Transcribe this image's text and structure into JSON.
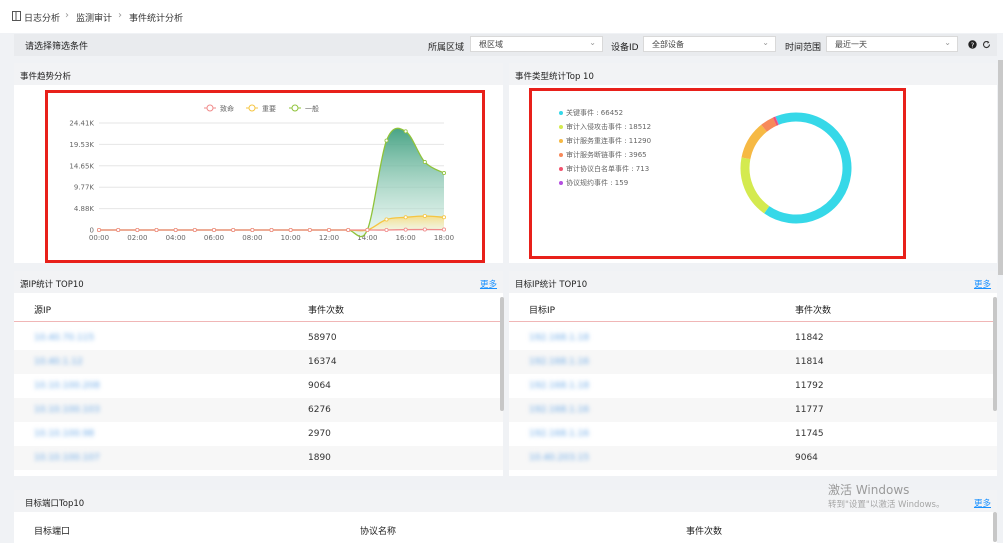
{
  "breadcrumb": {
    "items": [
      "日志分析",
      "监测审计",
      "事件统计分析"
    ]
  },
  "filters": {
    "title": "请选择筛选条件",
    "region": {
      "label": "所属区域",
      "value": "根区域"
    },
    "device": {
      "label": "设备ID",
      "value": "全部设备"
    },
    "timerange": {
      "label": "时间范围",
      "value": "最近一天"
    }
  },
  "trend": {
    "title": "事件趋势分析"
  },
  "toptypes": {
    "title": "事件类型统计Top 10",
    "legend": [
      {
        "label": "关键事件 : 66452",
        "color": "#36d8e8"
      },
      {
        "label": "审计入侵攻击事件 : 18512",
        "color": "#d4ea4f"
      },
      {
        "label": "审计服务重连事件 : 11290",
        "color": "#f6b944"
      },
      {
        "label": "审计服务断链事件 : 3965",
        "color": "#f7895a"
      },
      {
        "label": "审计协议白名单事件 : 713",
        "color": "#f1546f"
      },
      {
        "label": "协议规约事件 : 159",
        "color": "#b44fe0"
      }
    ]
  },
  "chart_data": [
    {
      "type": "line",
      "legend": [
        "致命",
        "重要",
        "一般"
      ],
      "colors": [
        "#f08a8a",
        "#f5c542",
        "#8fc33a"
      ],
      "x": [
        "00:00",
        "01:00",
        "02:00",
        "03:00",
        "04:00",
        "05:00",
        "06:00",
        "07:00",
        "08:00",
        "09:00",
        "10:00",
        "11:00",
        "12:00",
        "13:00",
        "14:00",
        "15:00",
        "16:00",
        "17:00",
        "18:00"
      ],
      "xticks": [
        "00:00",
        "02:00",
        "04:00",
        "06:00",
        "08:00",
        "10:00",
        "12:00",
        "14:00",
        "16:00",
        "18:00"
      ],
      "yticks": [
        "0",
        "4.88K",
        "9.77K",
        "14.65K",
        "19.53K",
        "24.41K"
      ],
      "ylim": [
        0,
        24410
      ],
      "series": [
        {
          "name": "致命",
          "values": [
            0,
            0,
            0,
            0,
            0,
            0,
            0,
            0,
            0,
            0,
            0,
            0,
            0,
            0,
            0,
            0,
            80,
            120,
            100
          ]
        },
        {
          "name": "重要",
          "values": [
            0,
            0,
            0,
            0,
            0,
            0,
            0,
            0,
            0,
            0,
            0,
            0,
            0,
            0,
            0,
            2400,
            2900,
            3200,
            2900
          ]
        },
        {
          "name": "一般",
          "values": [
            0,
            0,
            0,
            0,
            0,
            0,
            0,
            0,
            0,
            0,
            0,
            0,
            0,
            0,
            0,
            20400,
            22500,
            15500,
            13000
          ]
        }
      ]
    },
    {
      "type": "pie",
      "categories": [
        "关键事件",
        "审计入侵攻击事件",
        "审计服务重连事件",
        "审计服务断链事件",
        "审计协议白名单事件",
        "协议规约事件"
      ],
      "values": [
        66452,
        18512,
        11290,
        3965,
        713,
        159
      ]
    }
  ],
  "source_ip": {
    "title": "源IP统计 TOP10",
    "more": "更多",
    "headers": [
      "源IP",
      "事件次数"
    ],
    "rows": [
      {
        "ip": "10.40.70.115",
        "count": "58970"
      },
      {
        "ip": "10.40.1.12",
        "count": "16374"
      },
      {
        "ip": "10.10.100.208",
        "count": "9064"
      },
      {
        "ip": "10.10.100.103",
        "count": "6276"
      },
      {
        "ip": "10.10.100.98",
        "count": "2970"
      },
      {
        "ip": "10.10.100.107",
        "count": "1890"
      }
    ]
  },
  "target_ip": {
    "title": "目标IP统计 TOP10",
    "more": "更多",
    "headers": [
      "目标IP",
      "事件次数"
    ],
    "rows": [
      {
        "ip": "192.168.1.18",
        "count": "11842"
      },
      {
        "ip": "192.168.1.16",
        "count": "11814"
      },
      {
        "ip": "192.168.1.18",
        "count": "11792"
      },
      {
        "ip": "192.168.1.16",
        "count": "11777"
      },
      {
        "ip": "192.168.1.16",
        "count": "11745"
      },
      {
        "ip": "10.40.203.15",
        "count": "9064"
      }
    ]
  },
  "target_port": {
    "title": "目标端口Top10",
    "more": "更多",
    "headers": [
      "目标端口",
      "协议名称",
      "事件次数"
    ]
  },
  "watermark": {
    "line1": "激活 Windows",
    "line2": "转到\"设置\"以激活 Windows。"
  }
}
